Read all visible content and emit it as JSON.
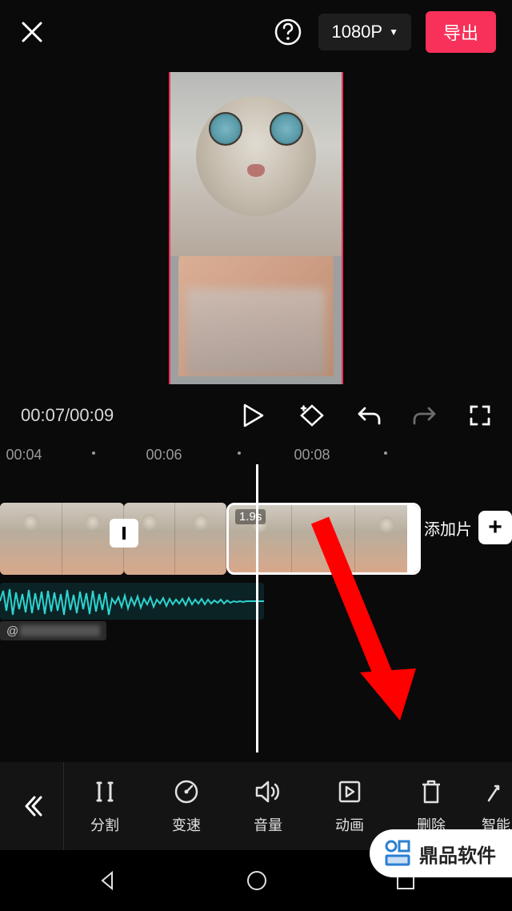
{
  "header": {
    "resolution": "1080P",
    "export_label": "导出"
  },
  "playback": {
    "timecode": "00:07/00:09"
  },
  "ruler": {
    "t1": "00:04",
    "t2": "00:06",
    "t3": "00:08"
  },
  "timeline": {
    "selected_duration": "1.9s",
    "add_clip_label": "添加片",
    "user_prefix": "@"
  },
  "toolbar": {
    "items": [
      {
        "label": "分割"
      },
      {
        "label": "变速"
      },
      {
        "label": "音量"
      },
      {
        "label": "动画"
      },
      {
        "label": "删除"
      },
      {
        "label": "智能"
      }
    ]
  },
  "watermark": {
    "text": "鼎品软件"
  }
}
